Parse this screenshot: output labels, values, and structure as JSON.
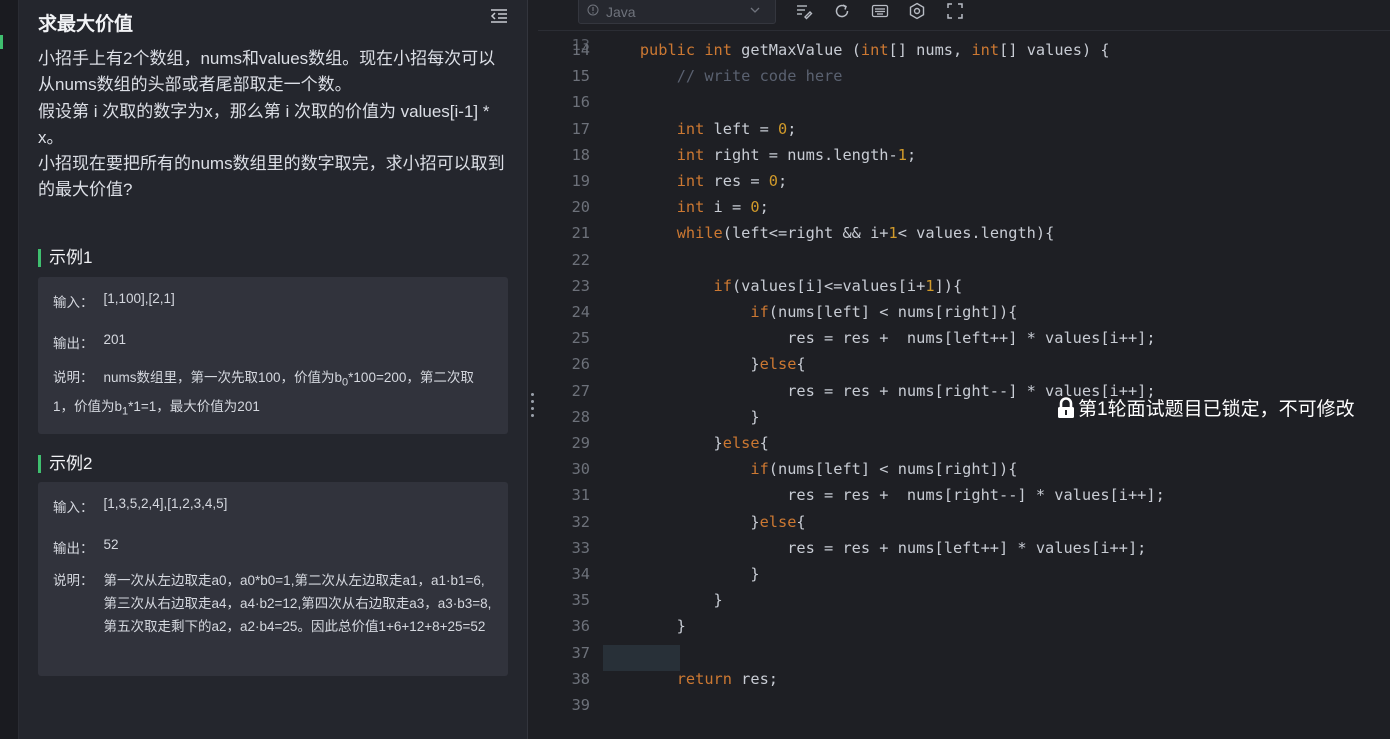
{
  "problem": {
    "title": "求最大价值",
    "description": [
      "小招手上有2个数组，nums和values数组。现在小招每次可以从nums数组的头部或者尾部取走一个数。",
      "假设第 i 次取的数字为x，那么第 i 次取的价值为 values[i-1] * x。",
      "小招现在要把所有的nums数组里的数字取完，求小招可以取到的最大价值?"
    ],
    "examples": [
      {
        "heading": "示例1",
        "input_label": "输入：",
        "input": "[1,100],[2,1]",
        "output_label": "输出：",
        "output": "201",
        "explain_label": "说明：",
        "explain_a": "nums数组里，第一次先取100，价值为b",
        "explain_b": "0",
        "explain_c": "*100=200，第二次取1，价值为b",
        "explain_d": "1",
        "explain_e": "*1=1，最大价值为201"
      },
      {
        "heading": "示例2",
        "input_label": "输入：",
        "input": "[1,3,5,2,4],[1,2,3,4,5]",
        "output_label": "输出：",
        "output": "52",
        "explain_label": "说明：",
        "explain": "第一次从左边取走a0，a0*b0=1,第二次从左边取走a1，a1·b1=6,第三次从右边取走a4，a4·b2=12,第四次从右边取走a3，a3·b3=8,第五次取走剩下的a2，a2·b4=25。因此总价值1+6+12+8+25=52"
      }
    ]
  },
  "editor": {
    "language": "Java",
    "lock_message": "第1轮面试题目已锁定，不可修改",
    "lines": [
      {
        "n": "14",
        "code": [
          [
            "",
            "    "
          ],
          [
            "kw",
            "public"
          ],
          [
            "",
            " "
          ],
          [
            "kw",
            "int"
          ],
          [
            "",
            " getMaxValue ("
          ],
          [
            "kw",
            "int"
          ],
          [
            "",
            "[] nums, "
          ],
          [
            "kw",
            "int"
          ],
          [
            "",
            "[] values) {"
          ]
        ]
      },
      {
        "n": "15",
        "code": [
          [
            "",
            "        "
          ],
          [
            "cm",
            "// write code here"
          ]
        ]
      },
      {
        "n": "16",
        "code": []
      },
      {
        "n": "17",
        "code": [
          [
            "",
            "        "
          ],
          [
            "kw",
            "int"
          ],
          [
            "",
            " left = "
          ],
          [
            "num",
            "0"
          ],
          [
            "",
            ";"
          ]
        ]
      },
      {
        "n": "18",
        "code": [
          [
            "",
            "        "
          ],
          [
            "kw",
            "int"
          ],
          [
            "",
            " right = nums.length-"
          ],
          [
            "num",
            "1"
          ],
          [
            "",
            ";"
          ]
        ]
      },
      {
        "n": "19",
        "code": [
          [
            "",
            "        "
          ],
          [
            "kw",
            "int"
          ],
          [
            "",
            " res = "
          ],
          [
            "num",
            "0"
          ],
          [
            "",
            ";"
          ]
        ]
      },
      {
        "n": "20",
        "code": [
          [
            "",
            "        "
          ],
          [
            "kw",
            "int"
          ],
          [
            "",
            " i = "
          ],
          [
            "num",
            "0"
          ],
          [
            "",
            ";"
          ]
        ]
      },
      {
        "n": "21",
        "code": [
          [
            "",
            "        "
          ],
          [
            "kw",
            "while"
          ],
          [
            "",
            "(left<=right && i+"
          ],
          [
            "num",
            "1"
          ],
          [
            "",
            "< values.length){"
          ]
        ]
      },
      {
        "n": "22",
        "code": []
      },
      {
        "n": "23",
        "code": [
          [
            "",
            "            "
          ],
          [
            "kw",
            "if"
          ],
          [
            "",
            "(values[i]<=values[i+"
          ],
          [
            "num",
            "1"
          ],
          [
            "",
            "]){"
          ]
        ]
      },
      {
        "n": "24",
        "code": [
          [
            "",
            "                "
          ],
          [
            "kw",
            "if"
          ],
          [
            "",
            "(nums[left] < nums[right]){"
          ]
        ]
      },
      {
        "n": "25",
        "code": [
          [
            "",
            "                    res = res +  nums[left++] * values[i++];"
          ]
        ]
      },
      {
        "n": "26",
        "code": [
          [
            "",
            "                }"
          ],
          [
            "kw",
            "else"
          ],
          [
            "",
            "{"
          ]
        ]
      },
      {
        "n": "27",
        "code": [
          [
            "",
            "                    res = res + nums[right--] * values[i++];"
          ]
        ]
      },
      {
        "n": "28",
        "code": [
          [
            "",
            "                }"
          ]
        ]
      },
      {
        "n": "29",
        "code": [
          [
            "",
            "            }"
          ],
          [
            "kw",
            "else"
          ],
          [
            "",
            "{"
          ]
        ]
      },
      {
        "n": "30",
        "code": [
          [
            "",
            "                "
          ],
          [
            "kw",
            "if"
          ],
          [
            "",
            "(nums[left] < nums[right]){"
          ]
        ]
      },
      {
        "n": "31",
        "code": [
          [
            "",
            "                    res = res +  nums[right--] * values[i++];"
          ]
        ]
      },
      {
        "n": "32",
        "code": [
          [
            "",
            "                }"
          ],
          [
            "kw",
            "else"
          ],
          [
            "",
            "{"
          ]
        ]
      },
      {
        "n": "33",
        "code": [
          [
            "",
            "                    res = res + nums[left++] * values[i++];"
          ]
        ]
      },
      {
        "n": "34",
        "code": [
          [
            "",
            "                }"
          ]
        ]
      },
      {
        "n": "35",
        "code": [
          [
            "",
            "            }"
          ]
        ]
      },
      {
        "n": "36",
        "code": [
          [
            "",
            "        }"
          ]
        ]
      },
      {
        "n": "37",
        "code": []
      },
      {
        "n": "38",
        "code": [
          [
            "",
            "        "
          ],
          [
            "kw",
            "return"
          ],
          [
            "",
            " res;"
          ]
        ]
      },
      {
        "n": "39",
        "code": []
      }
    ]
  },
  "colors": {
    "accent": "#3fbf6f",
    "keyword": "#cc7832",
    "number": "#d19a2a",
    "comment": "#5a6170"
  }
}
